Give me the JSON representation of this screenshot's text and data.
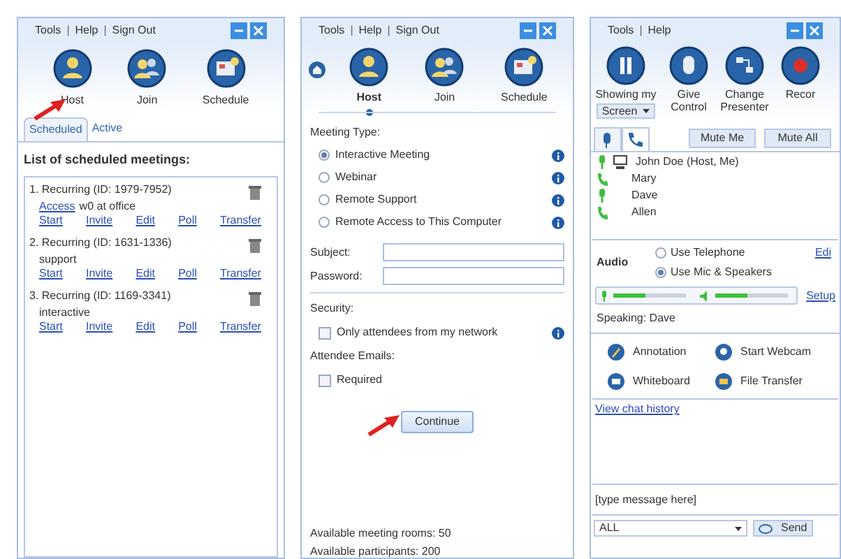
{
  "schedule_panel": {
    "menu": [
      "Tools",
      "|",
      "Help",
      "|",
      "Sign Out"
    ],
    "actions": [
      "Host",
      "Join",
      "Schedule"
    ],
    "tabs": [
      {
        "label": "Scheduled",
        "selected": true
      },
      {
        "label": "Active",
        "selected": false
      }
    ],
    "list_title": "List of scheduled meetings:",
    "meetings": [
      {
        "title": "1. Recurring (ID: 1979-7952)",
        "link": "Access",
        "note": "w0 at office",
        "links": [
          "Start",
          "Invite",
          "Edit",
          "Poll",
          "Transfer"
        ]
      },
      {
        "title": "2. Recurring (ID: 1631-1336)",
        "note": "support",
        "links": [
          "Start",
          "Invite",
          "Edit",
          "Poll",
          "Transfer"
        ]
      },
      {
        "title": "3. Recurring (ID: 1169-3341)",
        "note": "interactive",
        "links": [
          "Start",
          "Invite",
          "Edit",
          "Poll",
          "Transfer"
        ]
      }
    ]
  },
  "host_panel": {
    "menu": [
      "Tools",
      "|",
      "Help",
      "|",
      "Sign Out"
    ],
    "actions": [
      {
        "label": "Host",
        "selected": true
      },
      {
        "label": "Join",
        "selected": false
      },
      {
        "label": "Schedule",
        "selected": false
      }
    ],
    "meeting_type_label": "Meeting Type:",
    "meeting_types": [
      {
        "label": "Interactive Meeting",
        "selected": true
      },
      {
        "label": "Webinar",
        "selected": false
      },
      {
        "label": "Remote Support",
        "selected": false
      },
      {
        "label": "Remote Access to This Computer",
        "selected": false
      }
    ],
    "subject_label": "Subject:",
    "password_label": "Password:",
    "security_label": "Security:",
    "security_option": {
      "label": "Only attendees from my network",
      "checked": false
    },
    "attendee_emails_label": "Attendee Emails:",
    "required_option": {
      "label": "Required",
      "checked": false
    },
    "continue_button": "Continue",
    "available_rooms": "Available meeting rooms: 50",
    "available_participants": "Available participants: 200"
  },
  "meeting_panel": {
    "menu": [
      "Tools",
      "|",
      "Help"
    ],
    "showing_label": "Showing my",
    "showing_value": "Screen",
    "actions": [
      "Give Control",
      "Change Presenter",
      "Recor"
    ],
    "mute_buttons": [
      "Mute Me",
      "Mute All"
    ],
    "participants": [
      {
        "name": "John Doe (Host, Me)",
        "kind": "mic",
        "computer": true
      },
      {
        "name": "Mary",
        "kind": "phone",
        "computer": false
      },
      {
        "name": "Dave",
        "kind": "mic",
        "computer": false
      },
      {
        "name": "Allen",
        "kind": "phone",
        "computer": false
      }
    ],
    "audio_label": "Audio",
    "audio_options": [
      {
        "label": "Use Telephone",
        "selected": false
      },
      {
        "label": "Use Mic & Speakers",
        "selected": true
      }
    ],
    "edit_link": "Edi",
    "mic": {
      "level": 0.45
    },
    "speaker": {
      "level": 0.45
    },
    "setup_link": "Setup",
    "speaking": "Speaking: Dave",
    "tools": [
      "Annotation",
      "Start Webcam",
      "Whiteboard",
      "File Transfer"
    ],
    "chat_history_link": "View chat history",
    "message_field": {
      "placeholder": "[type message here]"
    },
    "recipient": "ALL",
    "send_button": "Send"
  }
}
